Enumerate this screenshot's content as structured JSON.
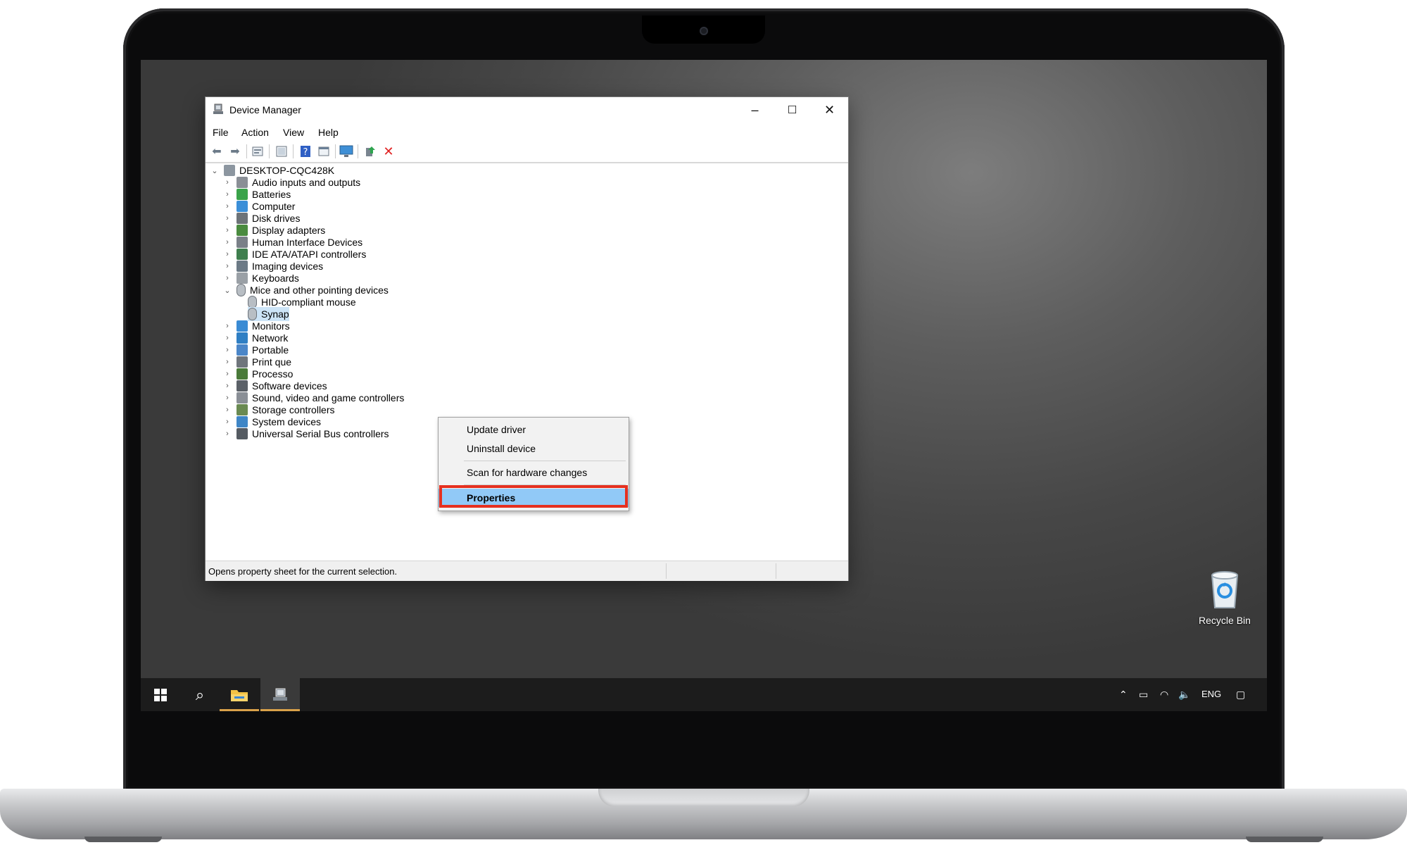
{
  "window": {
    "title": "Device Manager",
    "controls": {
      "minimize": "–",
      "maximize": "☐",
      "close": "✕"
    }
  },
  "menu": [
    "File",
    "Action",
    "View",
    "Help"
  ],
  "toolbar_icons": [
    "back-arrow",
    "forward-arrow",
    "properties",
    "show-hidden",
    "help",
    "resources-view",
    "computer-monitor",
    "update-driver",
    "uninstall"
  ],
  "tree": {
    "root": "DESKTOP-CQC428K",
    "categories": [
      {
        "label": "Audio inputs and outputs",
        "icon": "speaker",
        "expanded": false
      },
      {
        "label": "Batteries",
        "icon": "battery",
        "expanded": false
      },
      {
        "label": "Computer",
        "icon": "computer",
        "expanded": false
      },
      {
        "label": "Disk drives",
        "icon": "disk",
        "expanded": false
      },
      {
        "label": "Display adapters",
        "icon": "display",
        "expanded": false
      },
      {
        "label": "Human Interface Devices",
        "icon": "hid",
        "expanded": false
      },
      {
        "label": "IDE ATA/ATAPI controllers",
        "icon": "ide",
        "expanded": false
      },
      {
        "label": "Imaging devices",
        "icon": "camera",
        "expanded": false
      },
      {
        "label": "Keyboards",
        "icon": "keyboard",
        "expanded": false
      },
      {
        "label": "Mice and other pointing devices",
        "icon": "mouse",
        "expanded": true
      },
      {
        "label": "HID-compliant mouse",
        "icon": "mouse",
        "child": true
      },
      {
        "label": "Synap",
        "icon": "mouse",
        "child": true,
        "selected": true
      },
      {
        "label": "Monitors",
        "icon": "monitor",
        "expanded": false
      },
      {
        "label": "Network",
        "icon": "network",
        "expanded": false
      },
      {
        "label": "Portable",
        "icon": "portable",
        "expanded": false
      },
      {
        "label": "Print que",
        "icon": "printer",
        "expanded": false
      },
      {
        "label": "Processo",
        "icon": "processor",
        "expanded": false
      },
      {
        "label": "Software devices",
        "icon": "software",
        "expanded": false
      },
      {
        "label": "Sound, video and game controllers",
        "icon": "speaker",
        "expanded": false
      },
      {
        "label": "Storage controllers",
        "icon": "storage",
        "expanded": false
      },
      {
        "label": "System devices",
        "icon": "system",
        "expanded": false
      },
      {
        "label": "Universal Serial Bus controllers",
        "icon": "usb",
        "expanded": false
      }
    ]
  },
  "context_menu": {
    "items": [
      "Update driver",
      "Uninstall device",
      "Scan for hardware changes",
      "Properties"
    ],
    "highlighted": "Properties"
  },
  "status_bar": {
    "text": "Opens property sheet for the current selection."
  },
  "desktop": {
    "recycle_bin": "Recycle Bin"
  },
  "taskbar": {
    "language": "ENG"
  },
  "colors": {
    "highlight_border": "#e6301f",
    "menu_highlight": "#91c9f7",
    "selection": "#cce4f7"
  }
}
